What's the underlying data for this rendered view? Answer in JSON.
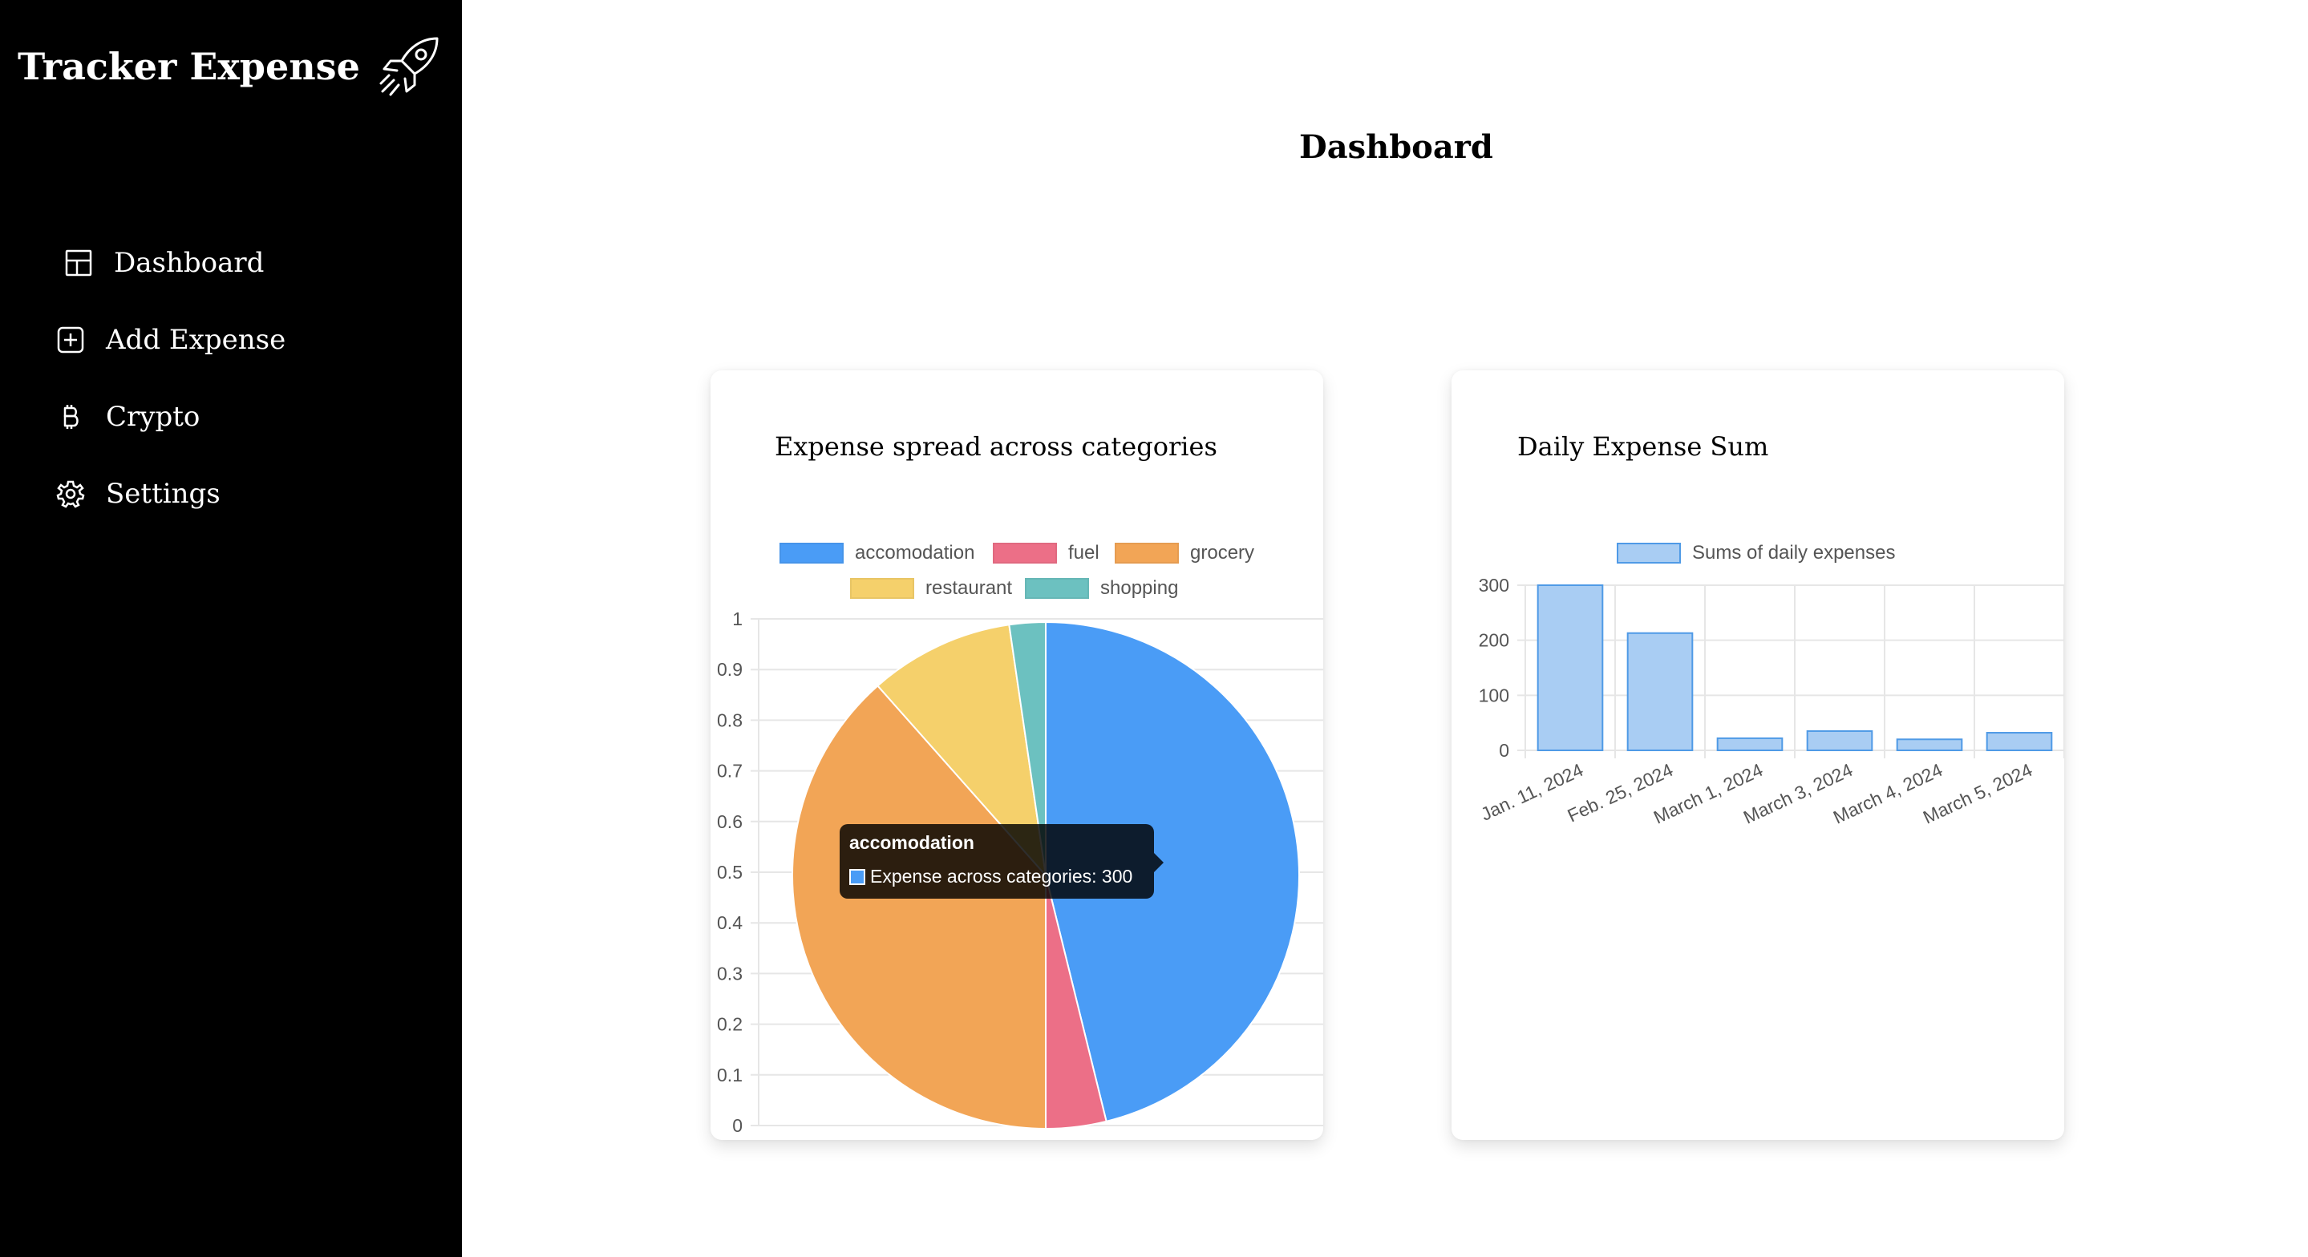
{
  "app": {
    "brand": "Tracker Expense",
    "brand_icon": "rocket-icon"
  },
  "sidebar": {
    "items": [
      {
        "label": "Dashboard",
        "icon": "dashboard-grid-icon"
      },
      {
        "label": "Add Expense",
        "icon": "plus-square-icon"
      },
      {
        "label": "Crypto",
        "icon": "bitcoin-icon"
      },
      {
        "label": "Settings",
        "icon": "gear-icon"
      }
    ]
  },
  "page": {
    "title": "Dashboard"
  },
  "colors": {
    "accomodation": "#4a9cf6",
    "fuel": "#ec6f87",
    "grocery": "#f2a556",
    "restaurant": "#f5d06b",
    "shopping": "#6cc1c0",
    "bar_fill": "#a9cdf3",
    "bar_border": "#4f9ae6"
  },
  "pie_card": {
    "title": "Expense spread across categories",
    "tooltip": {
      "title": "accomodation",
      "label": "Expense across categories: 300"
    }
  },
  "bar_card": {
    "title": "Daily Expense Sum"
  },
  "chart_data": [
    {
      "type": "pie",
      "series_name": "Expense across categories",
      "categories": [
        "accomodation",
        "fuel",
        "grocery",
        "restaurant",
        "shopping"
      ],
      "values": [
        300,
        25,
        250,
        60,
        15
      ],
      "y_ticks": [
        "0",
        "0.1",
        "0.2",
        "0.3",
        "0.4",
        "0.5",
        "0.6",
        "0.7",
        "0.8",
        "0.9",
        "1"
      ],
      "legend": "top"
    },
    {
      "type": "bar",
      "categories": [
        "Jan. 11, 2024",
        "Feb. 25, 2024",
        "March 1, 2024",
        "March 3, 2024",
        "March 4, 2024",
        "March 5, 2024"
      ],
      "series": [
        {
          "name": "Sums of daily expenses",
          "values": [
            300,
            213,
            22,
            35,
            20,
            32
          ]
        }
      ],
      "ylim": [
        0,
        300
      ],
      "y_ticks": [
        "0",
        "100",
        "200",
        "300"
      ],
      "legend": "top"
    }
  ]
}
